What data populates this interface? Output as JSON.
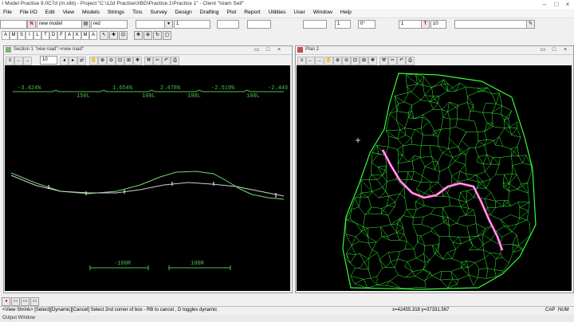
{
  "title": "l Model Practise 9.0C7d (m.xlib) - Project \"C:\\12d Practise\\XBD\\Practice 1\\Practice 1\" - Client \"Islam Seif\"",
  "menu": [
    "File",
    "File I/O",
    "Edit",
    "View",
    "Models",
    "Strings",
    "Tins",
    "Survey",
    "Design",
    "Drafting",
    "Plot",
    "Report",
    "Utilities",
    "User",
    "Window",
    "Help"
  ],
  "toolbar1": {
    "model_value": "new model",
    "colour_value": "red",
    "field1": "1",
    "field_a": "1",
    "field_b": "0°",
    "field_c": "1",
    "field_t": "10"
  },
  "toolbar2_letters": [
    "A",
    "M",
    "S",
    "I",
    "L",
    "T",
    "D",
    "F",
    "A",
    "K",
    "M",
    "A"
  ],
  "section": {
    "title": "Section 1 \"new road\"->new road\"",
    "zoom_value": "10",
    "grades": [
      "-3.424%",
      "1.654%",
      "2.478%",
      "-2.519%",
      "-2.446"
    ],
    "lengths": [
      "150L",
      "100L",
      "100L",
      "100L"
    ],
    "radii": [
      "-100R",
      "100R"
    ],
    "colors": {
      "grade": "#4fbf4f",
      "terrain": "#6fdc6f",
      "design": "#cfcfcf"
    }
  },
  "plan": {
    "title": "Plan 2",
    "colors": {
      "tin": "#33ff33",
      "road": "#ff44cc"
    }
  },
  "status": {
    "left": "<View Shrink> [Select][Dynamic][Cancel] Select 2nd corner of box - RB to cancel , D toggles dynamic",
    "coords": "x=42455.318 y=37331.567",
    "caps": "CAP",
    "num": "NUM"
  },
  "output_window": "Output Window"
}
